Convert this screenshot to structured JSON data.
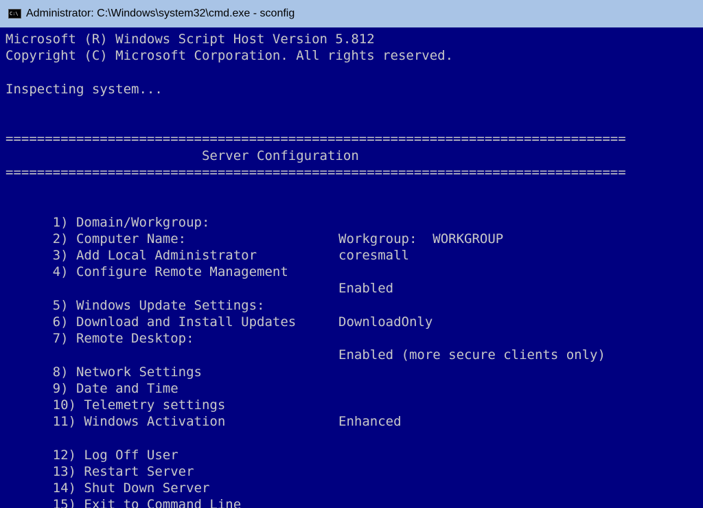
{
  "window": {
    "title": "Administrator: C:\\Windows\\system32\\cmd.exe - sconfig",
    "icon": "cmd-icon",
    "icon_text": "C:\\"
  },
  "colors": {
    "console_bg": "#000080",
    "console_fg": "#c8c8c8",
    "titlebar_bg": "#a9c4e6"
  },
  "console": {
    "header1": "Microsoft (R) Windows Script Host Version 5.812",
    "header2": "Copyright (C) Microsoft Corporation. All rights reserved.",
    "inspecting": "Inspecting system...",
    "rule": "===============================================================================",
    "section_title": "                         Server Configuration",
    "menu": [
      {
        "label": "1) Domain/Workgroup:",
        "value": "Workgroup:  WORKGROUP"
      },
      {
        "label": "2) Computer Name:",
        "value": "coresmall"
      },
      {
        "label": "3) Add Local Administrator",
        "value": ""
      },
      {
        "label": "4) Configure Remote Management",
        "value": "Enabled"
      },
      {
        "label": "5) Windows Update Settings:",
        "value": "DownloadOnly"
      },
      {
        "label": "6) Download and Install Updates",
        "value": ""
      },
      {
        "label": "7) Remote Desktop:",
        "value": "Enabled (more secure clients only)"
      },
      {
        "label": "8) Network Settings",
        "value": ""
      },
      {
        "label": "9) Date and Time",
        "value": ""
      },
      {
        "label": "10) Telemetry settings",
        "value": "Enhanced"
      },
      {
        "label": "11) Windows Activation",
        "value": ""
      },
      {
        "label": "12) Log Off User",
        "value": ""
      },
      {
        "label": "13) Restart Server",
        "value": ""
      },
      {
        "label": "14) Shut Down Server",
        "value": ""
      },
      {
        "label": "15) Exit to Command Line",
        "value": ""
      }
    ]
  }
}
